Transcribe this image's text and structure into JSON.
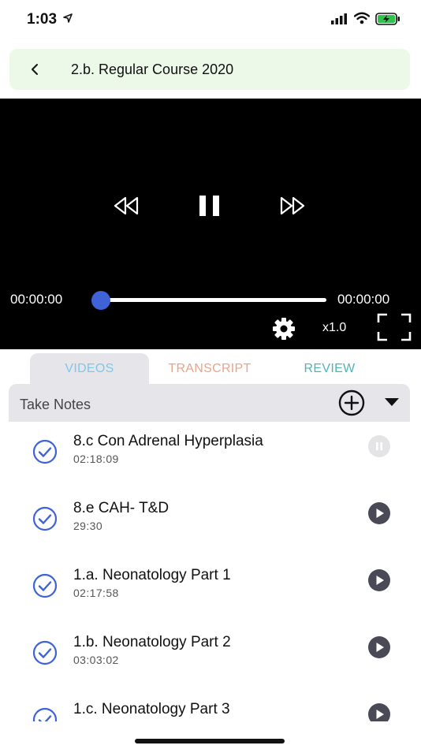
{
  "status": {
    "time": "1:03",
    "icons": [
      "location-arrow-icon",
      "signal-icon",
      "wifi-icon",
      "battery-charging-icon"
    ]
  },
  "header": {
    "title": "2.b. Regular Course 2020",
    "back_icon": "chevron-left-icon"
  },
  "player": {
    "current_time": "00:00:00",
    "total_time": "00:00:00",
    "progress": 0,
    "speed": "x1.0",
    "accent_color": "#3f63d6",
    "icons": [
      "rewind-icon",
      "pause-icon",
      "fast-forward-icon",
      "gear-icon",
      "fullscreen-icon"
    ]
  },
  "tabs": [
    {
      "label": "VIDEOS",
      "active": true,
      "color": "#7ec7ea"
    },
    {
      "label": "TRANSCRIPT",
      "active": false,
      "color": "#e7a58c"
    },
    {
      "label": "REVIEW",
      "active": false,
      "color": "#4fb4b9"
    }
  ],
  "notes": {
    "label": "Take Notes",
    "icons": [
      "plus-circle-icon",
      "caret-down-icon"
    ]
  },
  "videos": [
    {
      "title": "8.c Con Adrenal Hyperplasia",
      "duration": "02:18:09",
      "state": "playing"
    },
    {
      "title": "8.e CAH- T&D",
      "duration": "29:30",
      "state": "idle"
    },
    {
      "title": "1.a. Neonatology Part 1",
      "duration": "02:17:58",
      "state": "idle"
    },
    {
      "title": "1.b. Neonatology Part 2",
      "duration": "03:03:02",
      "state": "idle"
    },
    {
      "title": "1.c. Neonatology Part 3",
      "duration": "",
      "state": "idle"
    }
  ]
}
